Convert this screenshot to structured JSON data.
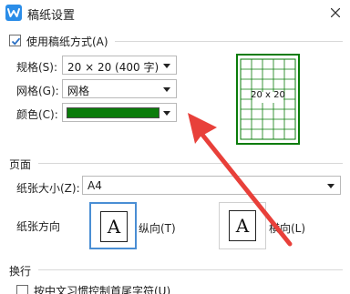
{
  "window": {
    "title": "稿纸设置",
    "icon": "wps-writer-icon",
    "close_icon": "close-icon"
  },
  "use_paper": {
    "label": "使用稿纸方式(A)",
    "checked": true
  },
  "spec": {
    "label": "规格(S):",
    "value": "20 × 20 (400 字)"
  },
  "grid": {
    "label": "网格(G):",
    "value": "网格"
  },
  "color": {
    "label": "颜色(C):",
    "value_color": "#0a7c0a"
  },
  "preview": {
    "label": "20 x 20",
    "line_color": "#0a7c0a"
  },
  "page_section": {
    "title": "页面",
    "paper_size_label": "纸张大小(Z):",
    "paper_size_value": "A4",
    "orientation_label": "纸张方向",
    "portrait_label": "纵向(T)",
    "landscape_label": "横向(L)",
    "portrait_glyph": "A",
    "landscape_glyph": "A",
    "selected": "portrait"
  },
  "wrap_section": {
    "title": "换行",
    "option_label": "按中文习惯控制首尾字符(U)"
  },
  "annotation": {
    "arrow_color": "#e8403a"
  }
}
